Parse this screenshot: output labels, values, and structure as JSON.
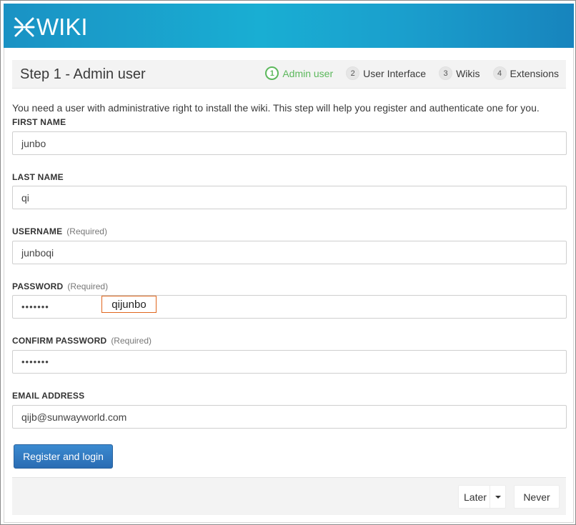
{
  "header": {
    "logo_text": "WIKI",
    "logo_icon": "xwiki-x-icon"
  },
  "step_bar": {
    "title": "Step 1 - Admin user",
    "steps": [
      {
        "num": "1",
        "label": "Admin user",
        "active": true
      },
      {
        "num": "2",
        "label": "User Interface",
        "active": false
      },
      {
        "num": "3",
        "label": "Wikis",
        "active": false
      },
      {
        "num": "4",
        "label": "Extensions",
        "active": false
      }
    ]
  },
  "intro": "You need a user with administrative right to install the wiki. This step will help you register and authenticate one for you.",
  "form": {
    "first_name": {
      "label": "FIRST NAME",
      "value": "junbo"
    },
    "last_name": {
      "label": "LAST NAME",
      "value": "qi"
    },
    "username": {
      "label": "USERNAME",
      "required": "(Required)",
      "value": "junboqi"
    },
    "password": {
      "label": "PASSWORD",
      "required": "(Required)",
      "value": "•••••••"
    },
    "confirm_password": {
      "label": "CONFIRM PASSWORD",
      "required": "(Required)",
      "value": "•••••••"
    },
    "email": {
      "label": "EMAIL ADDRESS",
      "value": "qijb@sunwayworld.com"
    }
  },
  "annotation": "qijunbo",
  "buttons": {
    "register": "Register and login",
    "later": "Later",
    "never": "Never"
  },
  "colors": {
    "header_start": "#1a92c4",
    "header_end": "#1784bd",
    "active_step": "#5cb85c",
    "primary_button": "#2a6cb3",
    "annotation_border": "#e0661d"
  }
}
